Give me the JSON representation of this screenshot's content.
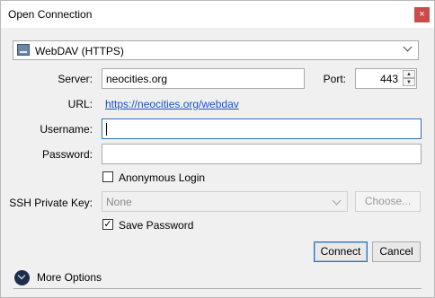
{
  "window": {
    "title": "Open Connection",
    "close_glyph": "×"
  },
  "protocol": {
    "selected": "WebDAV (HTTPS)",
    "icon": "drive-icon"
  },
  "server": {
    "label": "Server:",
    "value": "neocities.org"
  },
  "port": {
    "label": "Port:",
    "value": "443"
  },
  "url": {
    "label": "URL:",
    "value": "https://neocities.org/webdav"
  },
  "username": {
    "label": "Username:",
    "value": ""
  },
  "password": {
    "label": "Password:",
    "value": ""
  },
  "anonymous": {
    "label": "Anonymous Login",
    "checked": false
  },
  "ssh": {
    "label": "SSH Private Key:",
    "selected": "None",
    "choose_label": "Choose..."
  },
  "save_password": {
    "label": "Save Password",
    "checked": true,
    "check_glyph": "✓"
  },
  "actions": {
    "connect_label": "Connect",
    "cancel_label": "Cancel"
  },
  "more_options": {
    "label": "More Options"
  },
  "colors": {
    "link": "#1a4fd1",
    "focus_border": "#2f73b5",
    "close_bg": "#c94b4b"
  }
}
